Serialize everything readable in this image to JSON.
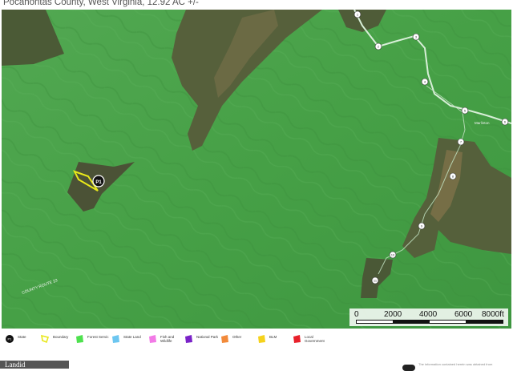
{
  "title": "Pocahontas County, West Virginia, 12.92 AC +/-",
  "map": {
    "route_label": "COUNTY ROUTE 23",
    "parcel_marker": "P1",
    "road_markers": [
      "1",
      "2",
      "3",
      "4",
      "5",
      "6",
      "7",
      "8",
      "9",
      "10",
      "11"
    ],
    "place_label": "Marlinton",
    "colors": {
      "forest_service": "#4aa04a",
      "boundary": "#e8e81a",
      "road": "#d8efd8"
    }
  },
  "scale": {
    "labels": [
      "0",
      "2000",
      "4000",
      "6000",
      "8000ft"
    ]
  },
  "legend": [
    {
      "label": "State",
      "color": "#111111",
      "icon": "state-icon"
    },
    {
      "label": "Boundary",
      "color": "#e8e81a",
      "icon": "boundary-icon"
    },
    {
      "label": "Forest Servic",
      "color": "#4ee14e",
      "icon": "forest-service-icon"
    },
    {
      "label": "State Land",
      "color": "#6cc6f0",
      "icon": "state-land-icon"
    },
    {
      "label": "Fish and Wildlife",
      "color": "#f27ae6",
      "icon": "fish-wildlife-icon"
    },
    {
      "label": "National Park",
      "color": "#7a22c8",
      "icon": "national-park-icon"
    },
    {
      "label": "Other",
      "color": "#f28a3a",
      "icon": "other-icon"
    },
    {
      "label": "BLM",
      "color": "#f5d21c",
      "icon": "blm-icon"
    },
    {
      "label": "Local Government",
      "color": "#e8202a",
      "icon": "local-government-icon"
    }
  ],
  "footer": {
    "logo_text": "Landid",
    "disclaimer": "The information contained herein was obtained from"
  }
}
